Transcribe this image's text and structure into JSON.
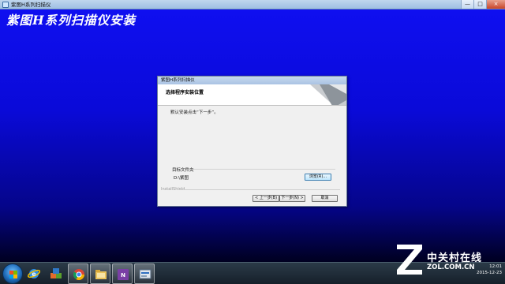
{
  "window": {
    "title": "紫图H系列扫描仪",
    "controls": [
      "—",
      "□",
      "×"
    ]
  },
  "installer": {
    "heading": "紫图H系列扫描仪安装"
  },
  "dialog": {
    "title": "紫图H系列扫描仪",
    "header_title": "选择程序安装位置",
    "body_text": "默认安装点击“下一步”。",
    "dest_group_label": "目标文件夹",
    "dest_path": "D:\\紫图",
    "browse_label": "浏览(R)...",
    "installshield_label": "InstallShield",
    "back_label": "< 上一步(B)",
    "next_label": "下一步(N) >",
    "cancel_label": "取消"
  },
  "taskbar": {
    "items": [
      {
        "icon": "ie-icon",
        "active": false
      },
      {
        "icon": "programs-icon",
        "active": false
      },
      {
        "icon": "chrome-icon",
        "active": true
      },
      {
        "icon": "folder-icon",
        "active": true
      },
      {
        "icon": "onenote-icon",
        "active": true
      },
      {
        "icon": "scanner-installer-icon",
        "active": true
      }
    ],
    "clock_time": "12:01",
    "clock_date": "2015-12-23"
  },
  "watermark": {
    "name": "中关村在线",
    "domain": "ZOL.COM.CN"
  }
}
